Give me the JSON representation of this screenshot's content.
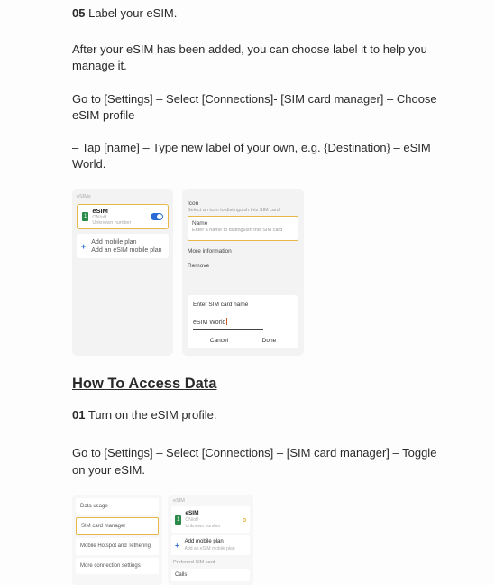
{
  "step5": {
    "num": "05",
    "title": "Label your eSIM."
  },
  "p1": "After your eSIM has been added, you can choose label it to help you manage it.",
  "p2": "Go to [Settings] – Select [Connections]- [SIM card manager] – Choose eSIM profile",
  "p3": "– Tap [name] – Type new label of your own, e.g. {Destination} – eSIM World.",
  "shot1": {
    "left": {
      "tag": "1",
      "title": "eSIM",
      "sub1": "ON/off",
      "sub2": "Unknown number",
      "addTitle": "Add mobile plan",
      "addSub": "Add an eSIM mobile plan"
    },
    "right": {
      "iconHead": "Icon",
      "iconSub": "Select an icon to distinguish this SIM card",
      "nameHead": "Name",
      "nameSub": "Enter a name to distinguish this SIM card",
      "more": "More information",
      "remove": "Remove",
      "enterTitle": "Enter SIM card name",
      "enterVal": "eSIM World",
      "cancel": "Cancel",
      "done": "Done"
    }
  },
  "h2": "How To Access Data",
  "step1": {
    "num": "01",
    "title": "Turn on the eSIM profile."
  },
  "p4": "Go to [Settings] – Select [Connections] – [SIM card manager] – Toggle on your eSIM.",
  "shot2": {
    "left": {
      "r1": "Data usage",
      "r2": "SIM card manager",
      "r3": "Mobile Hotspot and Tethering",
      "r4": "More connection settings"
    },
    "right": {
      "head": "eSIM",
      "tag": "1",
      "t": "eSIM",
      "s1": "ON/off",
      "s2": "Unknown number",
      "add": "Add mobile plan",
      "addSub": "Add an eSIM mobile plan",
      "sec": "Preferred SIM card",
      "calls": "Calls"
    }
  }
}
